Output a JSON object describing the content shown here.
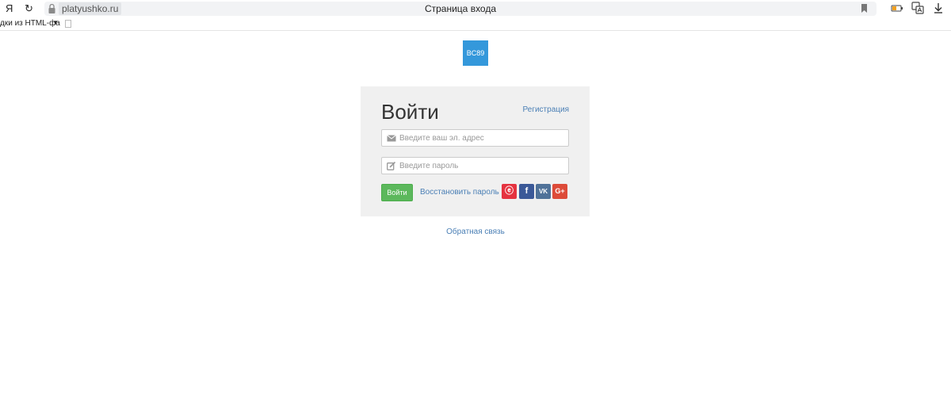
{
  "browser": {
    "nav_back": "Я",
    "nav_reload": "↻",
    "domain": "platyushko.ru",
    "tab_title": "Страница входа",
    "bookmarks_label": "дки из HTML-фа",
    "bookmarks_arrow": "▼"
  },
  "logo": {
    "text": "BC89"
  },
  "login": {
    "title": "Войти",
    "register_link": "Регистрация",
    "email_placeholder": "Введите ваш эл. адрес",
    "password_placeholder": "Введите пароль",
    "submit_label": "Войти",
    "recover_link": "Восстановить пароль"
  },
  "social": {
    "ok": "ⓔ",
    "facebook": "f",
    "vk": "VK",
    "google": "G+"
  },
  "footer": {
    "feedback_link": "Обратная связь"
  },
  "colors": {
    "logo": "#3498db",
    "submit": "#5cb85c",
    "link": "#4a7fb5",
    "panel": "#f0f0f0"
  }
}
